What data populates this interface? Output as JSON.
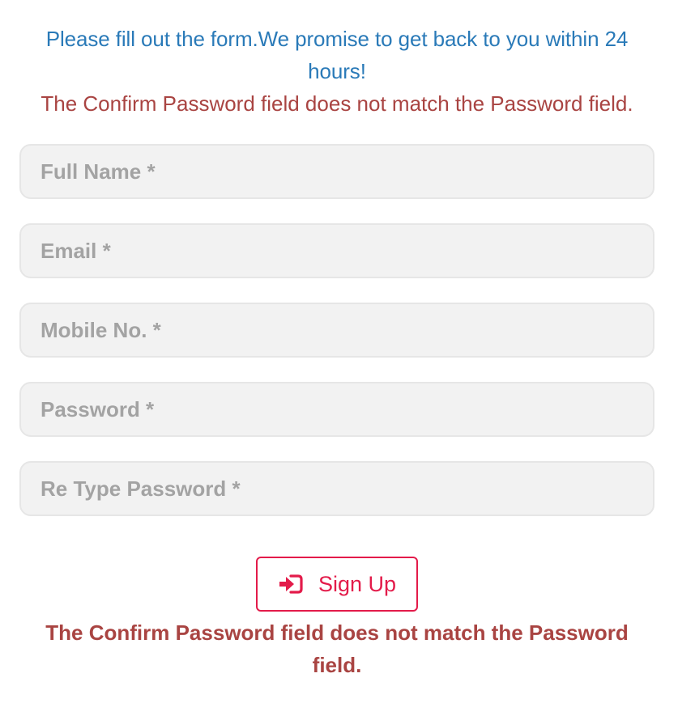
{
  "form": {
    "intro_text": "Please fill out the form.We promise to get back to you within 24 hours!",
    "error_top": "The Confirm Password field does not match the Password field.",
    "fields": [
      {
        "placeholder": "Full Name *",
        "value": ""
      },
      {
        "placeholder": "Email *",
        "value": ""
      },
      {
        "placeholder": "Mobile No. *",
        "value": ""
      },
      {
        "placeholder": "Password *",
        "value": ""
      },
      {
        "placeholder": "Re Type Password *",
        "value": ""
      }
    ],
    "submit_label": "Sign Up",
    "submit_icon": "sign-in-icon",
    "error_bottom": "The Confirm Password field does not match the Password field."
  },
  "colors": {
    "intro": "#2a7ab8",
    "error": "#a94442",
    "accent": "#e31b4a",
    "field_bg": "#f2f2f2",
    "placeholder": "#a3a3a3"
  }
}
